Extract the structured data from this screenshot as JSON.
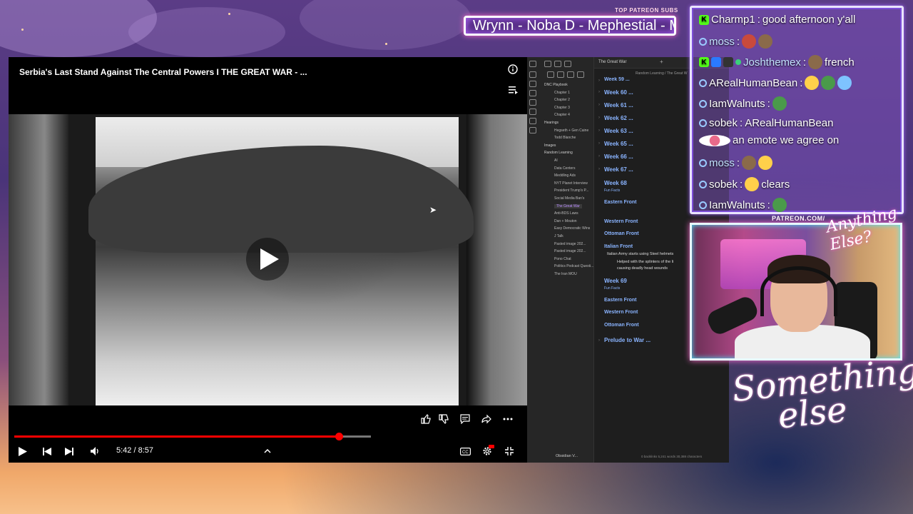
{
  "overlay": {
    "patreon_label": "TOP PATREON SUBS",
    "patreon_names": "Wrynn -  Noba D - Mephestial - M",
    "patreon_url": "PATREON.COM/",
    "brand_line1": "Something",
    "brand_line2": "else",
    "cam_logo": "Anything Else?"
  },
  "player": {
    "title": "Serbia's Last Stand Against The Central Powers I THE GREAT WAR - ...",
    "time": "5:42 / 8:57",
    "progress": 0.91,
    "icons": {
      "info": "info-icon",
      "playlist": "playlist-icon",
      "like": "thumbs-up-icon",
      "dislike": "thumbs-down-icon",
      "comment": "comment-icon",
      "share": "share-icon",
      "more": "more-icon",
      "play": "play-icon",
      "prev": "previous-icon",
      "next": "next-icon",
      "volume": "volume-icon",
      "expand": "chevron-up-icon",
      "cc": "captions-icon",
      "settings": "settings-icon",
      "fullscreen": "fullscreen-exit-icon"
    },
    "accent": "#ff0000"
  },
  "obsidian": {
    "tab": "The Great War",
    "breadcrumb": "Random Learning  /  The Great W",
    "tree": [
      {
        "label": "DNC Playbook",
        "folder": true
      },
      {
        "label": "Chapter 1"
      },
      {
        "label": "Chapter 2"
      },
      {
        "label": "Chapter 3"
      },
      {
        "label": "Chapter 4"
      },
      {
        "label": "Hearings",
        "folder": true
      },
      {
        "label": "Hegseth + Gen Caine"
      },
      {
        "label": "Todd Blanche"
      },
      {
        "label": "Images",
        "folder": true
      },
      {
        "label": "Random Learning",
        "folder": true
      },
      {
        "label": "AI"
      },
      {
        "label": "Data Centers"
      },
      {
        "label": "Meddling Ads"
      },
      {
        "label": "NYT Planet Interview"
      },
      {
        "label": "President Trump's P..."
      },
      {
        "label": "Social Media Ban's"
      },
      {
        "label": "The Great War",
        "active": true
      },
      {
        "label": "Anti-BDS Laws"
      },
      {
        "label": "Dan + Mouton"
      },
      {
        "label": "Easy Democratic Wins"
      },
      {
        "label": "J Talk"
      },
      {
        "label": "Pasted image 202..."
      },
      {
        "label": "Pasted image 202..."
      },
      {
        "label": "Pono Chat"
      },
      {
        "label": "Politics Podcast Questi..."
      },
      {
        "label": "The Iran MOU"
      }
    ],
    "headings": {
      "w59": "Week 59 ...",
      "w60": "Week 60 ...",
      "w61": "Week 61 ...",
      "w62": "Week 62 ...",
      "w63": "Week 63 ...",
      "w65": "Week 65 ...",
      "w66": "Week 66 ...",
      "w67": "Week 67 ...",
      "w68": "Week 68",
      "fun1": "Fun Facts",
      "east1": "Eastern Front",
      "west1": "Western Front",
      "otto1": "Ottoman Front",
      "ital1": "Italian Front",
      "bullet1": "Italian Army starts using Steel helmets",
      "bullet2": "Helped with the splinters of the li",
      "bullet3": "causing deadly head wounds",
      "w69": "Week 69",
      "fun2": "Fun Facts",
      "east2": "Eastern Front",
      "west2": "Western Front",
      "otto2": "Ottoman Front",
      "prelude": "Prelude to War ..."
    },
    "vault": "Obsidian V...",
    "status": "0 backlinks   5,241 words  30,388 characters"
  },
  "chat": [
    {
      "user": "Charmp1",
      "msg": "good afternoon y'all",
      "badges": [
        "kick"
      ]
    },
    {
      "user": "moss",
      "msg": "",
      "badges": [
        "prime"
      ],
      "emotes": 2
    },
    {
      "user": "Joshthemex",
      "msg": "french",
      "badges": [
        "kick",
        "mod",
        "sub",
        "sub2"
      ],
      "emotes": 1
    },
    {
      "user": "ARealHumanBean",
      "msg": "",
      "badges": [
        "prime"
      ],
      "emotes": 3
    },
    {
      "user": "IamWalnuts",
      "msg": "",
      "badges": [
        "prime"
      ],
      "emotes": 1
    },
    {
      "user": "sobek",
      "msg": "ARealHumanBean",
      "badges": [
        "prime"
      ]
    },
    {
      "user": "",
      "msg": "an emote we agree on",
      "badges": []
    },
    {
      "user": "moss",
      "msg": "",
      "badges": [
        "prime"
      ],
      "emotes": 2
    },
    {
      "user": "sobek",
      "msg": "clears",
      "badges": [
        "prime"
      ],
      "emotes": 1
    },
    {
      "user": "IamWalnuts",
      "msg": "",
      "badges": [
        "prime"
      ],
      "emotes": 1
    }
  ]
}
